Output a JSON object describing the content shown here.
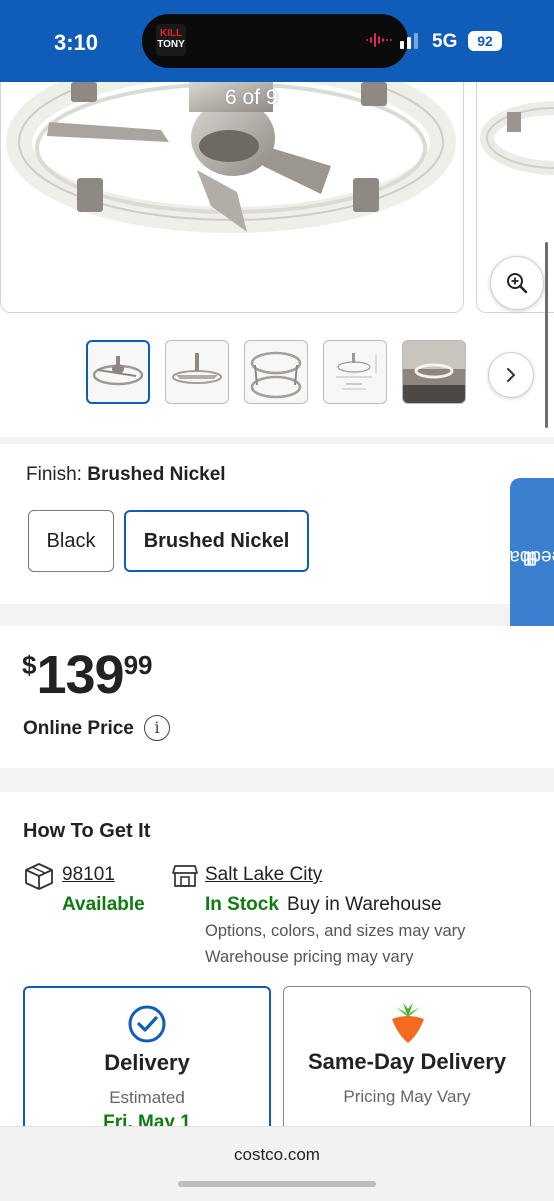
{
  "status_bar": {
    "time": "3:10",
    "now_playing_badge": [
      "KILL",
      "TONY"
    ],
    "network": "5G",
    "battery": "92",
    "signal_bars": 2
  },
  "gallery": {
    "counter": "6 of 9",
    "zoom_icon": "magnifier-plus-icon",
    "thumbnail_count": 5,
    "selected_thumbnail_index": 0,
    "next_icon": "chevron-right-icon"
  },
  "finish": {
    "label": "Finish:",
    "selected": "Brushed Nickel",
    "options": [
      "Black",
      "Brushed Nickel"
    ]
  },
  "feedback": {
    "label": "Feedback"
  },
  "price": {
    "currency": "$",
    "dollars": "139",
    "cents": "99",
    "label": "Online Price",
    "info_icon": "i"
  },
  "how_to_get": {
    "title": "How To Get It",
    "online": {
      "zip": "98101",
      "status": "Available"
    },
    "warehouse": {
      "name": "Salt Lake City",
      "status": "In Stock",
      "status_suffix": "Buy in Warehouse",
      "note_1": "Options, colors, and sizes may vary",
      "note_2": "Warehouse pricing may vary"
    },
    "delivery_card": {
      "title": "Delivery",
      "subtitle": "Estimated",
      "date": "Fri, May 1"
    },
    "same_day_card": {
      "title": "Same-Day Delivery",
      "subtitle": "Pricing May Vary"
    }
  },
  "browser": {
    "url": "costco.com"
  },
  "colors": {
    "brand_blue": "#0f5db8",
    "feedback_blue": "#3b7fd1",
    "success_green": "#107c10",
    "carrot_orange": "#f26b21",
    "carrot_green": "#43b02a"
  }
}
